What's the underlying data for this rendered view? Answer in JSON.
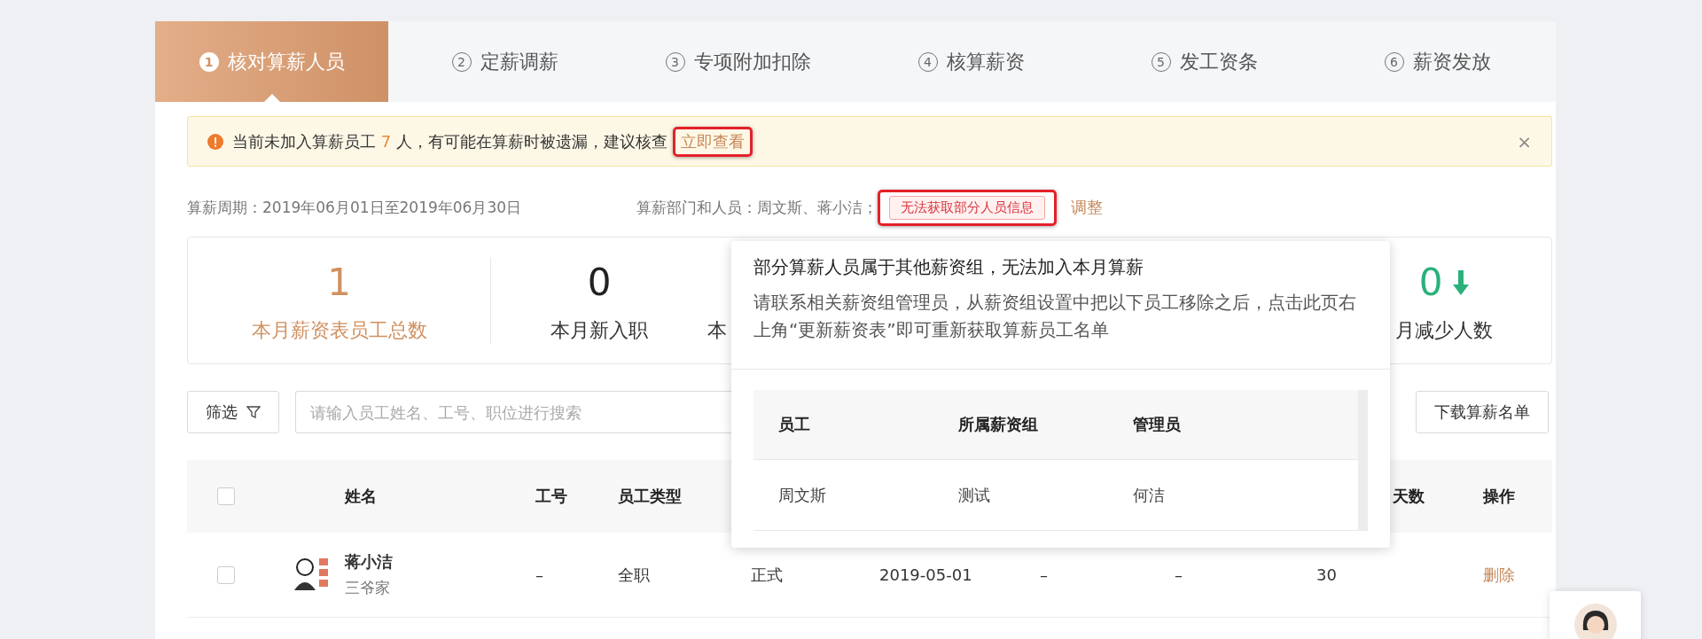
{
  "tabs": [
    {
      "number": "1",
      "label": "核对算薪人员",
      "selected": true
    },
    {
      "number": "2",
      "label": "定薪调薪",
      "selected": false
    },
    {
      "number": "3",
      "label": "专项附加扣除",
      "selected": false
    },
    {
      "number": "4",
      "label": "核算薪资",
      "selected": false
    },
    {
      "number": "5",
      "label": "发工资条",
      "selected": false
    },
    {
      "number": "6",
      "label": "薪资发放",
      "selected": false
    }
  ],
  "alert": {
    "text_before": "当前未加入算薪员工 ",
    "count": "7",
    "text_after": " 人，有可能在算薪时被遗漏，建议核查",
    "link": {
      "label": "立即查看",
      "highlighted": true
    },
    "close": "×"
  },
  "period": {
    "text": "算薪周期：2019年06月01日至2019年06月30日",
    "scope": "算薪部门和人员：周文斯、蒋小洁；",
    "tag": {
      "label": "无法获取部分人员信息",
      "highlighted": true
    },
    "adjust": "调整"
  },
  "stats": [
    {
      "value": "1",
      "label": "本月薪资表员工总数",
      "color": "#d0905f"
    },
    {
      "value": "0",
      "label": "本月新入职",
      "color": "#222222"
    },
    {
      "label": "本"
    },
    {
      "value": "0",
      "label": "月减少人数",
      "color": "#2bb07b",
      "kind": "decrease"
    }
  ],
  "toolbar": {
    "filter": "筛选",
    "search": {
      "placeholder": "请输入员工姓名、工号、职位进行搜索"
    },
    "download": "下载算薪名单"
  },
  "table": {
    "columns": [
      "姓名",
      "工号",
      "员工类型",
      "",
      "",
      "",
      "",
      "天数",
      "操作"
    ],
    "header_checked": false,
    "rows": [
      {
        "checked": false,
        "cells": [
          {
            "name": "蒋小洁",
            "sub": "三爷家"
          },
          "–",
          "全职",
          "正式",
          "2019-05-01",
          "–",
          "–",
          "30",
          "删除"
        ]
      }
    ]
  },
  "popover": {
    "title": "部分算薪人员属于其他薪资组，无法加入本月算薪",
    "body": "请联系相关薪资组管理员，从薪资组设置中把以下员工移除之后，点击此页右上角“更新薪资表”即可重新获取算薪员工名单",
    "columns": [
      "员工",
      "所属薪资组",
      "管理员"
    ],
    "rows": [
      [
        "周文斯",
        "测试",
        "何洁"
      ]
    ]
  }
}
